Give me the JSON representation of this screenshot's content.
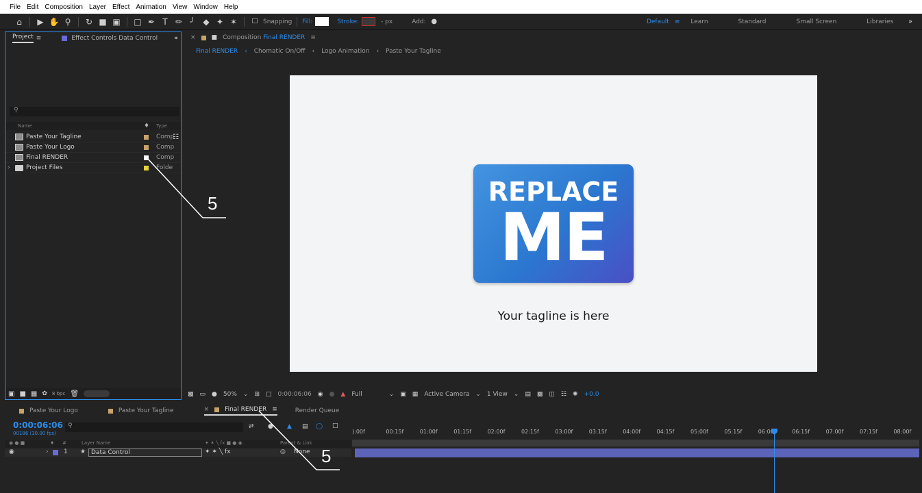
{
  "menu": [
    "File",
    "Edit",
    "Composition",
    "Layer",
    "Effect",
    "Animation",
    "View",
    "Window",
    "Help"
  ],
  "toolbar": {
    "snapping": "Snapping",
    "fill": "Fill:",
    "stroke": "Stroke:",
    "px": "- px",
    "add": "Add:"
  },
  "workspaces": [
    "Default",
    "Learn",
    "Standard",
    "Small Screen",
    "Libraries"
  ],
  "project": {
    "tab_project": "Project",
    "tab_effect_controls": "Effect Controls Data Control",
    "col_name": "Name",
    "col_type": "Type",
    "items": [
      {
        "name": "Paste Your Tagline",
        "type": "Comp",
        "color": "#c7a36a"
      },
      {
        "name": "Paste Your Logo",
        "type": "Comp",
        "color": "#c7a36a"
      },
      {
        "name": "Final RENDER",
        "type": "Comp",
        "color": "#c7a36a"
      },
      {
        "name": "Project Files",
        "type": "Folde",
        "color": "#e8d43a"
      }
    ],
    "bpc": "8 bpc"
  },
  "composition": {
    "header_label": "Composition",
    "header_name": "Final RENDER",
    "breadcrumbs": [
      "Final RENDER",
      "Chomatic On/Off",
      "Logo Animation",
      "Paste Your Tagline"
    ],
    "logo_line1": "REPLACE",
    "logo_line2": "ME",
    "tagline": "Your tagline is here",
    "zoom": "50%",
    "timecode": "0:00:06:06",
    "resolution": "Full",
    "camera": "Active Camera",
    "view": "1 View",
    "exposure": "+0.0"
  },
  "timeline": {
    "tabs": [
      "Paste Your Logo",
      "Paste Your Tagline",
      "Final RENDER",
      "Render Queue"
    ],
    "timecode": "0:00:06:06",
    "fps": "00186 (30.00 fps)",
    "col_layer_name": "Layer Name",
    "col_parent": "Parent & Link",
    "layer_num": "1",
    "layer_name": "Data Control",
    "parent": "None",
    "ticks": [
      "):00f",
      "00:15f",
      "01:00f",
      "01:15f",
      "02:00f",
      "02:15f",
      "03:00f",
      "03:15f",
      "04:00f",
      "04:15f",
      "05:00f",
      "05:15f",
      "06:00f",
      "06:15f",
      "07:00f",
      "07:15f",
      "08:00f"
    ]
  },
  "annotations": [
    "5",
    "5"
  ],
  "colors": {
    "accent": "#2d8ceb",
    "layer_bar": "#5b64b8"
  }
}
